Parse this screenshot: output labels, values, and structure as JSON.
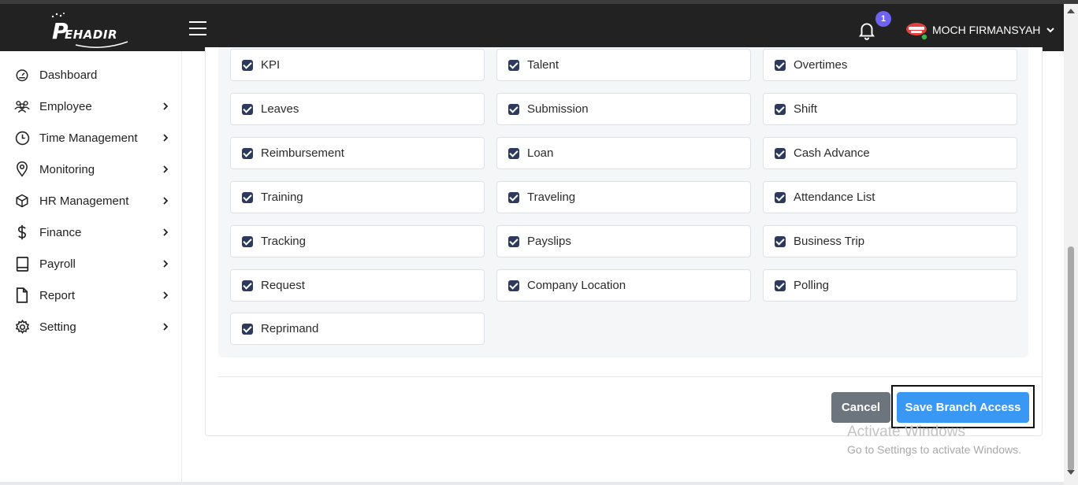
{
  "header": {
    "logo_text": "EHADIR",
    "logo_letter": "P",
    "notification_count": "1",
    "user_name": "MOCH FIRMANSYAH"
  },
  "sidebar": {
    "items": [
      {
        "label": "Dashboard",
        "icon": "dashboard-icon",
        "has_arrow": false
      },
      {
        "label": "Employee",
        "icon": "users-icon",
        "has_arrow": true
      },
      {
        "label": "Time Management",
        "icon": "clock-icon",
        "has_arrow": true
      },
      {
        "label": "Monitoring",
        "icon": "location-pin-icon",
        "has_arrow": true
      },
      {
        "label": "HR Management",
        "icon": "box-icon",
        "has_arrow": true
      },
      {
        "label": "Finance",
        "icon": "dollar-icon",
        "has_arrow": true
      },
      {
        "label": "Payroll",
        "icon": "book-icon",
        "has_arrow": true
      },
      {
        "label": "Report",
        "icon": "file-icon",
        "has_arrow": true
      },
      {
        "label": "Setting",
        "icon": "gear-icon",
        "has_arrow": true
      }
    ]
  },
  "permissions": [
    {
      "label": "KPI",
      "checked": true
    },
    {
      "label": "Talent",
      "checked": true
    },
    {
      "label": "Overtimes",
      "checked": true
    },
    {
      "label": "Leaves",
      "checked": true
    },
    {
      "label": "Submission",
      "checked": true
    },
    {
      "label": "Shift",
      "checked": true
    },
    {
      "label": "Reimbursement",
      "checked": true
    },
    {
      "label": "Loan",
      "checked": true
    },
    {
      "label": "Cash Advance",
      "checked": true
    },
    {
      "label": "Training",
      "checked": true
    },
    {
      "label": "Traveling",
      "checked": true
    },
    {
      "label": "Attendance List",
      "checked": true
    },
    {
      "label": "Tracking",
      "checked": true
    },
    {
      "label": "Payslips",
      "checked": true
    },
    {
      "label": "Business Trip",
      "checked": true
    },
    {
      "label": "Request",
      "checked": true
    },
    {
      "label": "Company Location",
      "checked": true
    },
    {
      "label": "Polling",
      "checked": true
    },
    {
      "label": "Reprimand",
      "checked": true
    }
  ],
  "actions": {
    "cancel_label": "Cancel",
    "save_label": "Save Branch Access"
  },
  "watermark": {
    "title": "Activate Windows",
    "subtitle": "Go to Settings to activate Windows."
  },
  "colors": {
    "topbar": "#222222",
    "checkbox": "#2e3a5c",
    "save_button": "#3898f3",
    "cancel_button": "#6c757d",
    "badge": "#6f63f2"
  }
}
